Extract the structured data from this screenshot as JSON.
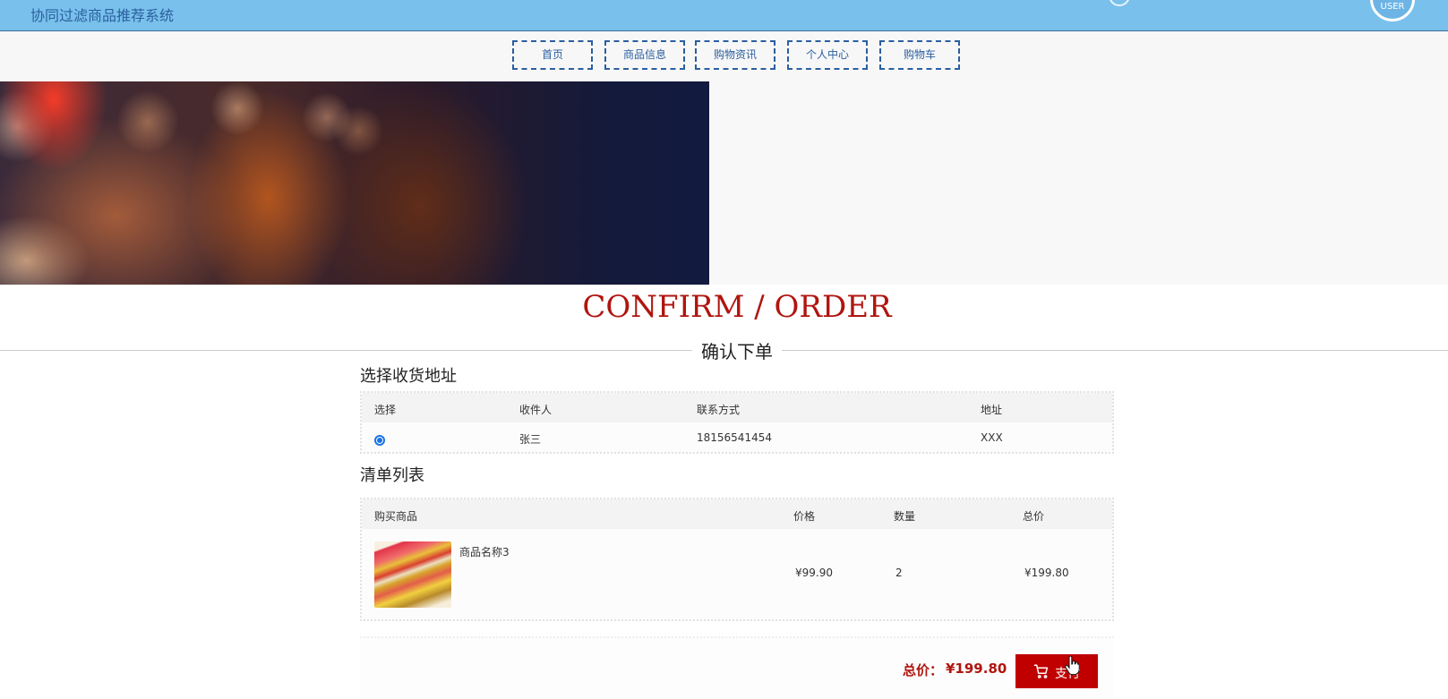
{
  "header": {
    "site_title": "协同过滤商品推荐系统",
    "avatar_text": "USER"
  },
  "nav": {
    "items": [
      "首页",
      "商品信息",
      "购物资讯",
      "个人中心",
      "购物车"
    ]
  },
  "section": {
    "title_en": "CONFIRM / ORDER",
    "title_cn": "确认下单"
  },
  "address": {
    "label": "选择收货地址",
    "headers": [
      "选择",
      "收件人",
      "联系方式",
      "地址"
    ],
    "rows": [
      {
        "selected": true,
        "recipient": "张三",
        "phone": "18156541454",
        "address": "XXX"
      }
    ]
  },
  "order_list": {
    "label": "清单列表",
    "headers": [
      "购买商品",
      "价格",
      "数量",
      "总价"
    ],
    "rows": [
      {
        "name": "商品名称3",
        "price": "¥99.90",
        "quantity": "2",
        "total": "¥199.80"
      }
    ]
  },
  "footer": {
    "total_label": "总价：",
    "total_value": "¥199.80",
    "pay_label": "支付"
  },
  "colors": {
    "header_bg": "#79c1ec",
    "accent_red": "#c00000",
    "nav_border": "#2b5fa0",
    "heading_red": "#b0150f"
  }
}
